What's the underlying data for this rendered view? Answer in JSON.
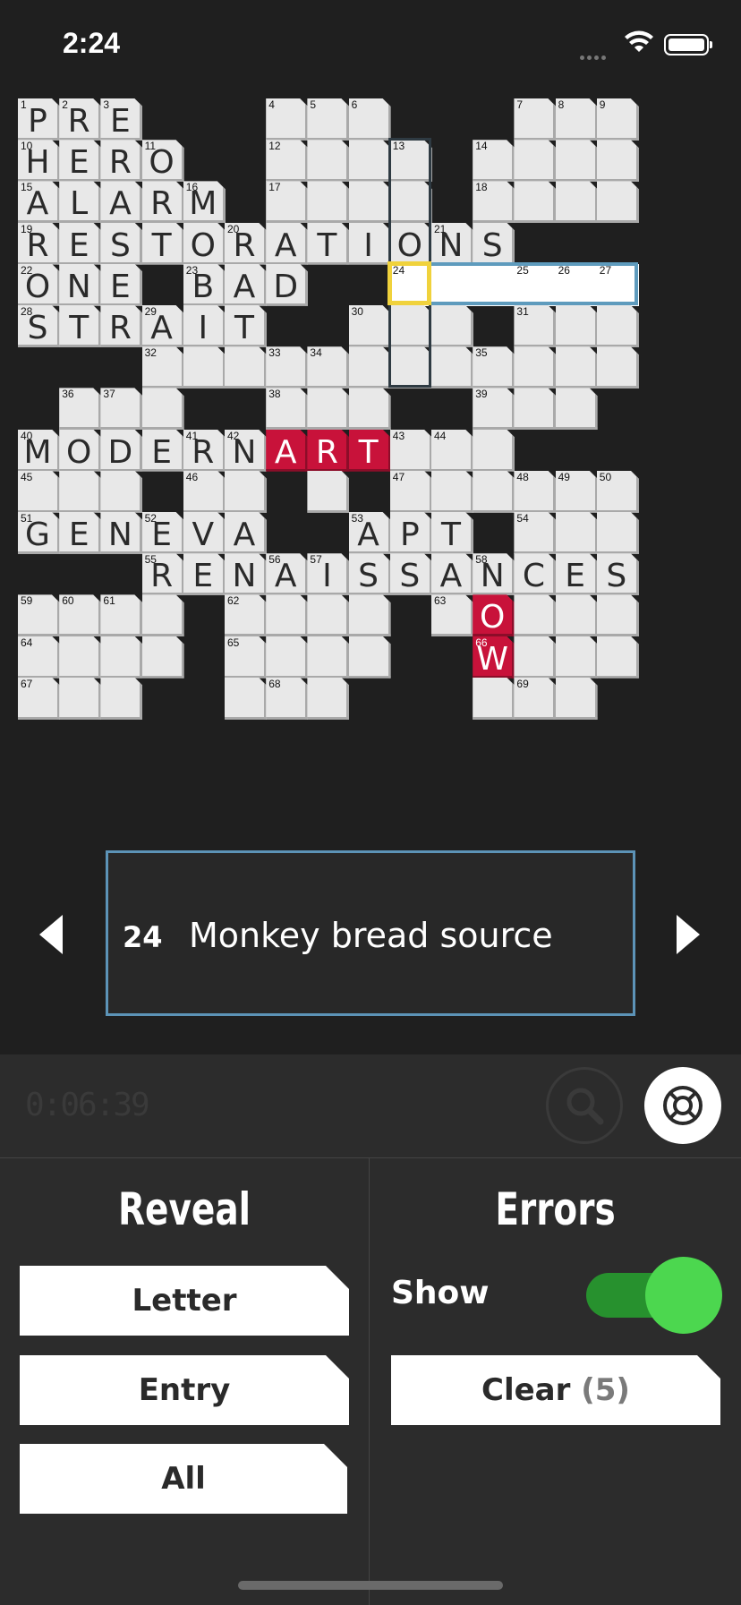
{
  "status": {
    "time": "2:24"
  },
  "colors": {
    "background": "#1f1f1f",
    "highlight": "#5e9bbd",
    "cursor": "#f0d23c",
    "revealed": "#c8123a",
    "toggle_on": "#4cd74f"
  },
  "puzzle": {
    "size": 15,
    "rows": [
      "PRE...___..___",
      "HERO.____._____",
      "ALARM.____.____",
      "RESTORATIONS...",
      "ONE.BAD..______",
      "STRAIT..___.___",
      "...____________",
      ".___..___..___.",
      "MODERNART__.___",
      "___.__.__._____",
      "GENEVA..APT.___",
      "...RENAISSANCES",
      "____.____.OW___",
      "____.____.W____",
      "___..___...___."
    ],
    "cells_note": "",
    "numbers": [],
    "revealed": [
      [
        8,
        7
      ],
      [
        8,
        8
      ],
      [
        8,
        9
      ],
      [
        12,
        11
      ],
      [
        13,
        11
      ]
    ],
    "selected_clue": {
      "number": "24",
      "row": 4,
      "col": 9,
      "length": 6
    }
  },
  "clue": {
    "number": "24",
    "text": "Monkey bread source"
  },
  "timer": "0:06:39",
  "icons": {
    "prev": "left-arrow-icon",
    "next": "right-arrow-icon",
    "search": "magnifier-icon",
    "help": "lifebuoy-icon"
  },
  "reveal": {
    "title": "Reveal",
    "letter": "Letter",
    "entry": "Entry",
    "all": "All"
  },
  "errors": {
    "title": "Errors",
    "show_label": "Show",
    "show_on": true,
    "clear_label": "Clear",
    "clear_count": "(5)"
  }
}
